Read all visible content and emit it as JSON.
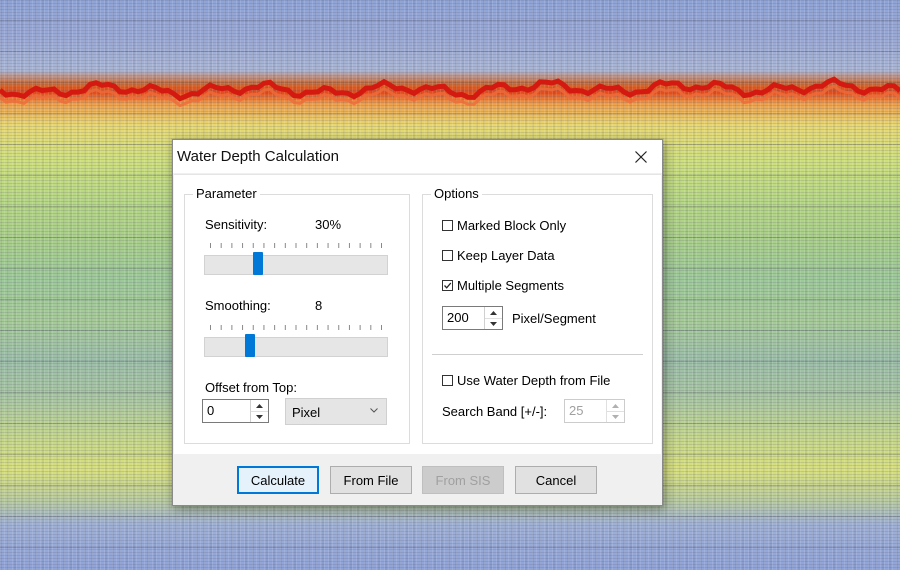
{
  "dialog": {
    "title": "Water Depth Calculation",
    "close_icon": "close-icon"
  },
  "parameter": {
    "group_title": "Parameter",
    "sensitivity_label": "Sensitivity:",
    "sensitivity_value": "30%",
    "sensitivity_level": 0.28,
    "smoothing_label": "Smoothing:",
    "smoothing_value": "8",
    "smoothing_level": 0.23,
    "offset_label": "Offset from Top:",
    "offset_value": "0",
    "unit_selected": "Pixel"
  },
  "options": {
    "group_title": "Options",
    "marked_block_only": {
      "label": "Marked Block Only",
      "checked": false
    },
    "keep_layer_data": {
      "label": "Keep Layer Data",
      "checked": false
    },
    "multiple_segments": {
      "label": "Multiple Segments",
      "checked": true
    },
    "pixel_segment_value": "200",
    "pixel_segment_label": "Pixel/Segment",
    "use_water_depth_from_file": {
      "label": "Use Water Depth from File",
      "checked": false
    },
    "search_band_label": "Search Band [+/-]:",
    "search_band_value": "25"
  },
  "buttons": {
    "calculate": "Calculate",
    "from_file": "From File",
    "from_sis": "From SIS",
    "cancel": "Cancel"
  },
  "colors": {
    "accent": "#0078d7",
    "dialog_bg": "#f0f0f0",
    "content_bg": "#ffffff"
  }
}
